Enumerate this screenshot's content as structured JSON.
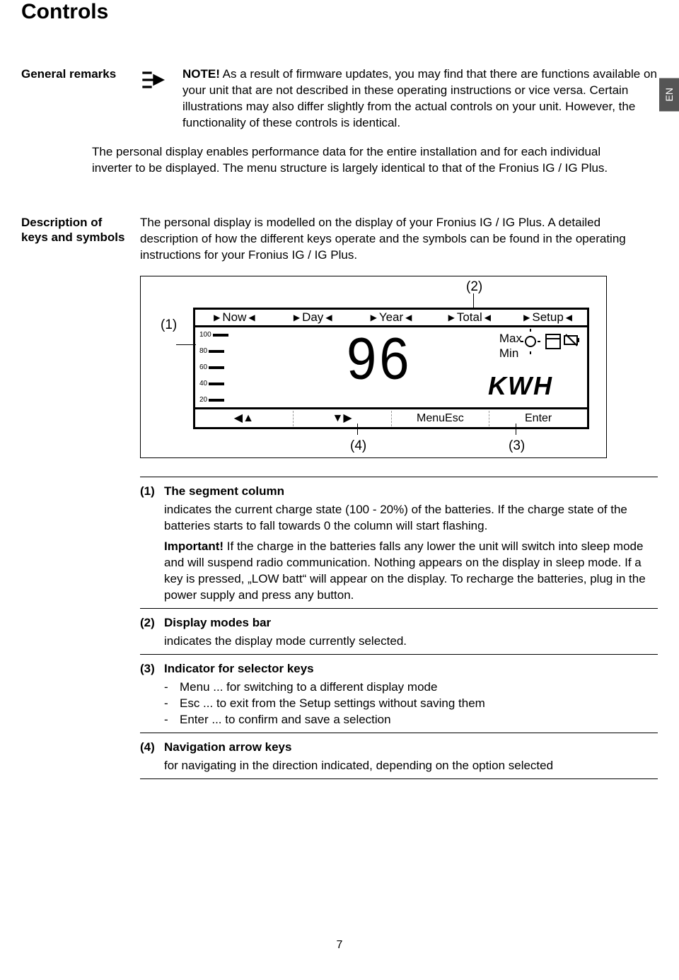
{
  "title": "Controls",
  "lang_tab": "EN",
  "page_number": "7",
  "section1": {
    "heading": "General remarks",
    "note_label": "NOTE!",
    "note_body": " As a result of firmware updates, you may find that there are functions available on your unit that are not described in these operating instructions or vice versa. Certain illustrations may also differ slightly from the actual controls on your unit. However, the functionality of these controls is identical.",
    "para2": "The personal display enables performance data for the entire installation and for each individual inverter to be displayed. The menu structure is largely identical to that of the Fronius IG / IG Plus."
  },
  "section2": {
    "heading": "Description of keys and symbols",
    "intro": "The personal display is modelled on the display of your Fronius IG / IG Plus. A detailed description of how the different keys operate and the symbols can be found in the operating instructions for your Fronius IG / IG Plus."
  },
  "diagram": {
    "callouts": {
      "c1": "(1)",
      "c2": "(2)",
      "c3": "(3)",
      "c4": "(4)"
    },
    "tabs": [
      "Now",
      "Day",
      "Year",
      "Total",
      "Setup"
    ],
    "bar_labels": [
      "100",
      "80",
      "60",
      "40",
      "20"
    ],
    "big_number": "96",
    "unit": "KWH",
    "max": "Max",
    "min": "Min",
    "bottom": {
      "left_arrows": "◀▲",
      "right_arrows": "▼▶",
      "menu_esc": "MenuEsc",
      "enter": "Enter"
    }
  },
  "legend": {
    "i1": {
      "num": "(1)",
      "title": "The segment column",
      "body": "indicates the current charge state (100 - 20%) of the batteries. If the charge state of the batteries starts to fall towards 0 the column will start flashing.",
      "important_label": "Important!",
      "important_body": " If the charge in the batteries falls any lower the unit will switch into sleep mode and will suspend radio communication. Nothing appears on the display in sleep mode. If a key is pressed, „LOW batt“ will appear on the display. To recharge the batteries, plug in the power supply and press any button."
    },
    "i2": {
      "num": "(2)",
      "title": "Display modes bar",
      "body": "indicates the display mode currently selected."
    },
    "i3": {
      "num": "(3)",
      "title": "Indicator for selector keys",
      "lines": [
        "Menu ... for switching to a different display mode",
        "Esc ... to exit from the Setup settings without saving them",
        "Enter ... to confirm and save a selection"
      ]
    },
    "i4": {
      "num": "(4)",
      "title": "Navigation arrow keys",
      "body": "for navigating in the direction indicated, depending on the option selected"
    }
  }
}
